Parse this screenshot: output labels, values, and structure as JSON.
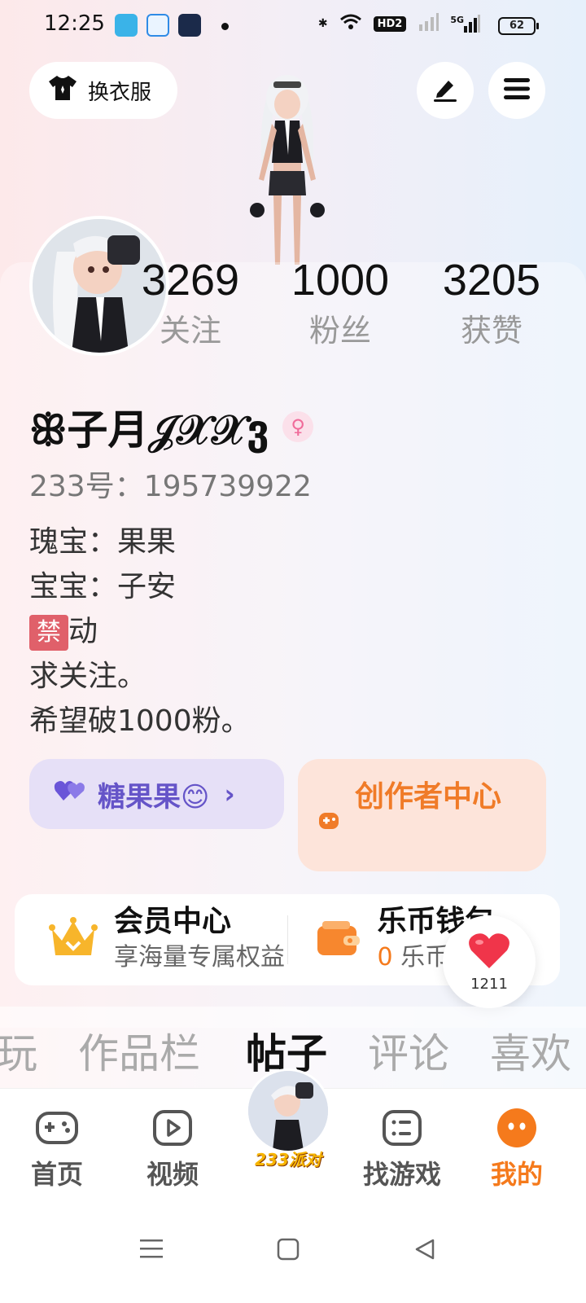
{
  "status_bar": {
    "time": "12:25",
    "battery": "62",
    "hd": "HD2",
    "net": "5G"
  },
  "header": {
    "outfit_label": "换衣服",
    "edit_icon": "pen-icon",
    "menu_icon": "hamburger-icon"
  },
  "stats": [
    {
      "value": "3269",
      "label": "关注"
    },
    {
      "value": "1000",
      "label": "粉丝"
    },
    {
      "value": "3205",
      "label": "获赞"
    }
  ],
  "profile": {
    "username": "ꕥ子月𝒥𝒳𝒳ვ",
    "gender_symbol": "♀",
    "uid": "233号：195739922",
    "bio": {
      "line1": "瑰宝：果果",
      "line2": "宝宝：子安",
      "ban_char": "禁",
      "line3_rest": "动",
      "line4": "求关注。",
      "line5": "希望破1000粉。"
    }
  },
  "pills": {
    "couple": "糖果果😊",
    "couple_arrow": "›",
    "creator": "创作者中心"
  },
  "vip": {
    "member_title": "会员中心",
    "member_sub": "享海量专属权益",
    "wallet_title": "乐币钱包",
    "wallet_amount": "0",
    "wallet_unit": "乐币"
  },
  "floating_like": {
    "count": "1211"
  },
  "tabs": [
    "玩",
    "作品栏",
    "帖子",
    "评论",
    "喜欢"
  ],
  "active_tab": "帖子",
  "bottom_nav": {
    "home": "首页",
    "video": "视频",
    "center": "233派对",
    "games": "找游戏",
    "mine": "我的"
  },
  "colors": {
    "accent": "#f57a1c",
    "purple": "#6554c8",
    "pink": "#f06b9a"
  }
}
